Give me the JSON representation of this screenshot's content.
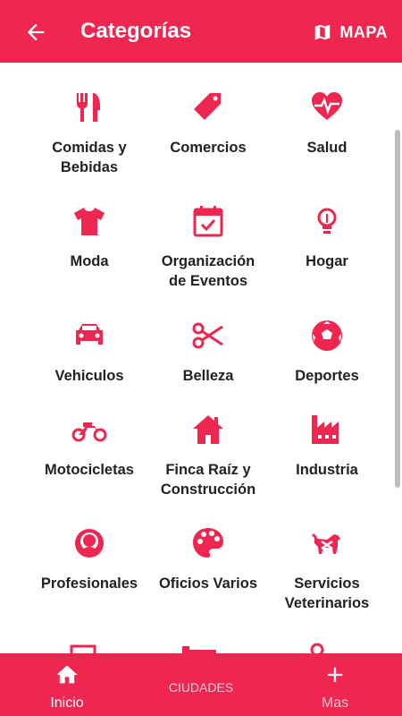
{
  "appbar": {
    "title": "Categorías",
    "map_label": "MAPA"
  },
  "categories": [
    {
      "label": "Comidas y\nBebidas",
      "icon": "utensils-icon"
    },
    {
      "label": "Comercios",
      "icon": "tag-icon"
    },
    {
      "label": "Salud",
      "icon": "heart-pulse-icon"
    },
    {
      "label": "Moda",
      "icon": "tshirt-icon"
    },
    {
      "label": "Organización\nde Eventos",
      "icon": "calendar-check-icon"
    },
    {
      "label": "Hogar",
      "icon": "lightbulb-icon"
    },
    {
      "label": "Vehiculos",
      "icon": "car-icon"
    },
    {
      "label": "Belleza",
      "icon": "scissors-icon"
    },
    {
      "label": "Deportes",
      "icon": "soccer-ball-icon"
    },
    {
      "label": "Motocicletas",
      "icon": "motorcycle-icon"
    },
    {
      "label": "Finca Raíz y\nConstrucción",
      "icon": "house-icon"
    },
    {
      "label": "Industria",
      "icon": "factory-icon"
    },
    {
      "label": "Profesionales",
      "icon": "person-icon"
    },
    {
      "label": "Oficios Varios",
      "icon": "palette-icon"
    },
    {
      "label": "Servicios\nVeterinarios",
      "icon": "dog-icon"
    }
  ],
  "bottom_nav": [
    {
      "label": "Inicio",
      "icon": "home-icon",
      "active": true
    },
    {
      "label": "CIUDADES",
      "icon": "",
      "active": false
    },
    {
      "label": "Mas",
      "icon": "plus-icon",
      "active": false
    }
  ],
  "colors": {
    "primary": "#ee2650",
    "text": "#222222"
  }
}
